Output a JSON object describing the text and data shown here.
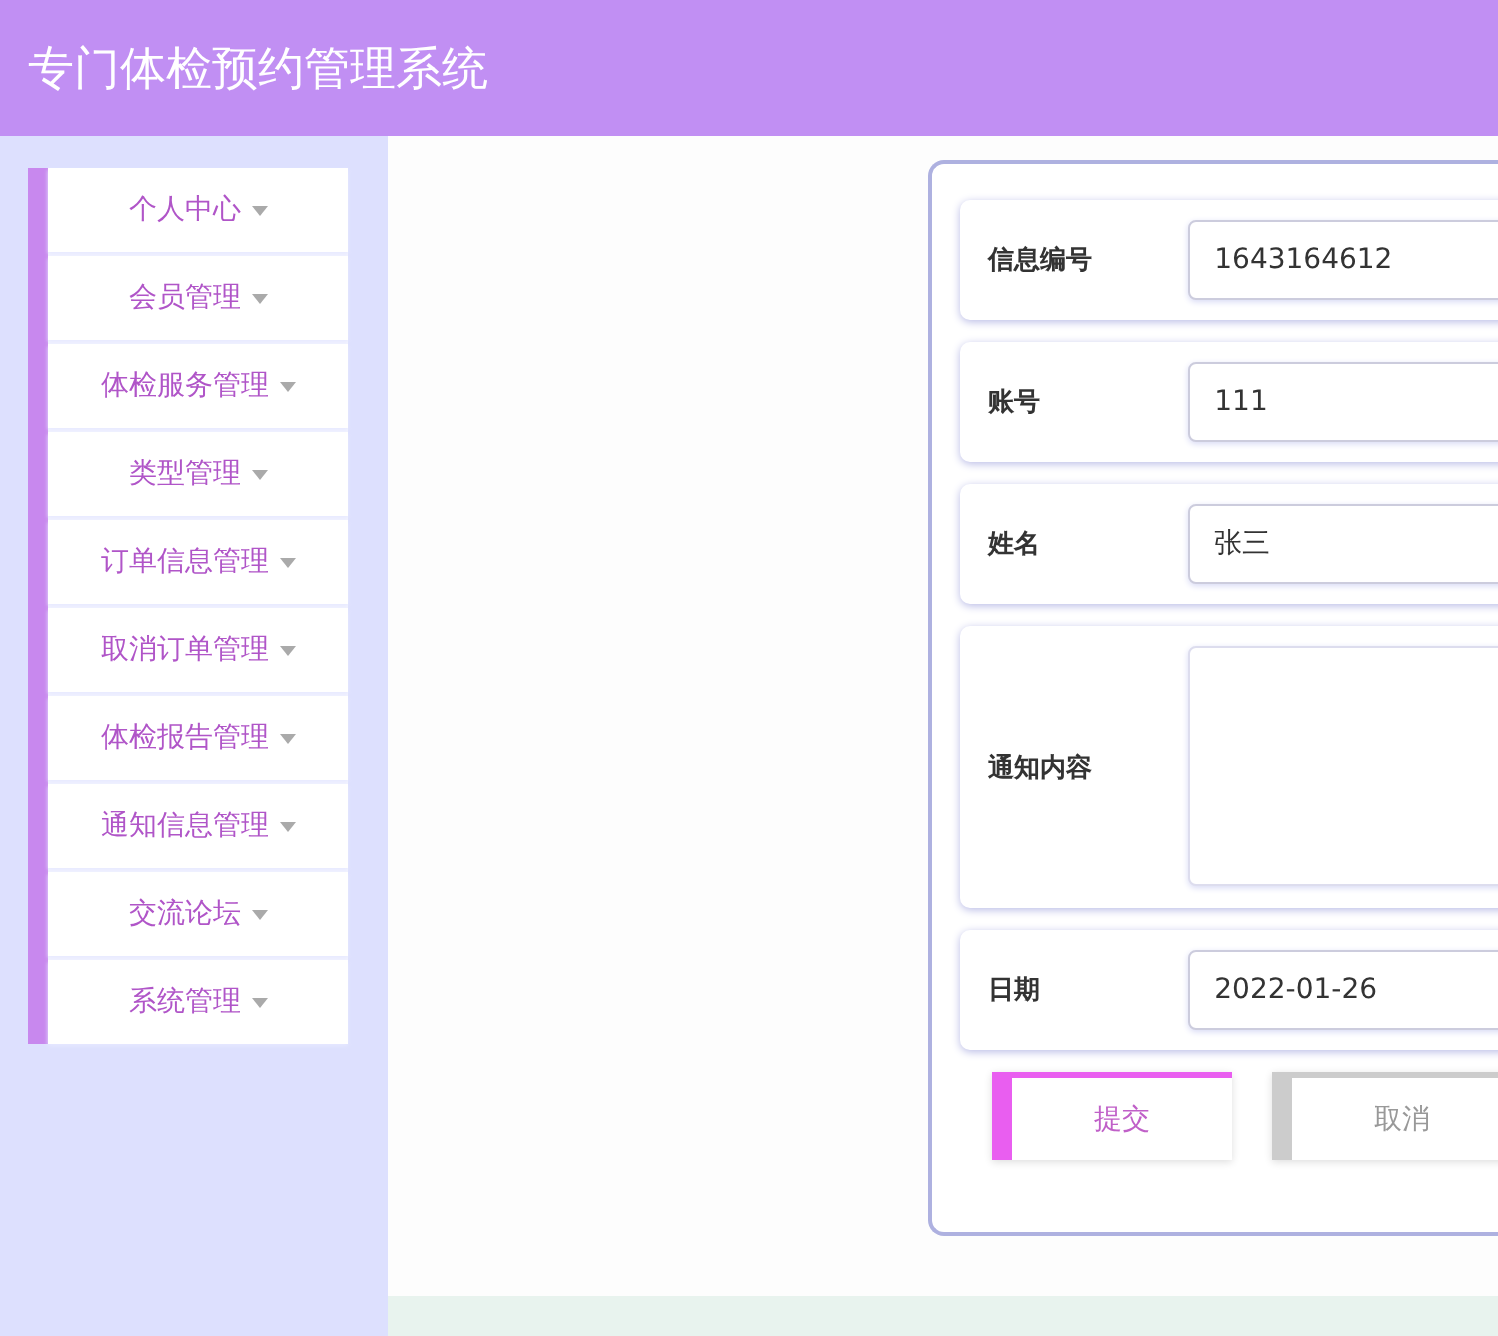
{
  "header": {
    "title": "专门体检预约管理系统"
  },
  "sidebar": {
    "items": [
      {
        "label": "个人中心"
      },
      {
        "label": "会员管理"
      },
      {
        "label": "体检服务管理"
      },
      {
        "label": "类型管理"
      },
      {
        "label": "订单信息管理"
      },
      {
        "label": "取消订单管理"
      },
      {
        "label": "体检报告管理"
      },
      {
        "label": "通知信息管理"
      },
      {
        "label": "交流论坛"
      },
      {
        "label": "系统管理"
      }
    ]
  },
  "form": {
    "fields": [
      {
        "label": "信息编号",
        "kind": "input",
        "value": "1643164612"
      },
      {
        "label": "账号",
        "kind": "input",
        "value": "111"
      },
      {
        "label": "姓名",
        "kind": "input",
        "value": "张三"
      },
      {
        "label": "通知内容",
        "kind": "textarea"
      },
      {
        "label": "日期",
        "kind": "input",
        "value": "2022-01-26"
      }
    ],
    "buttons": [
      {
        "label": "提交",
        "kind": "primary"
      },
      {
        "label": "取消",
        "kind": "default"
      }
    ]
  }
}
